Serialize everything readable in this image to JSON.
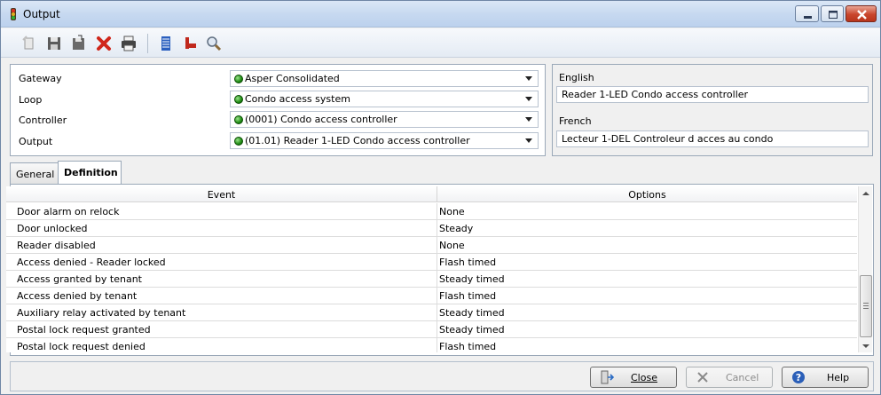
{
  "window": {
    "title": "Output",
    "icon": "traffic-light-icon"
  },
  "toolbar": {
    "buttons": [
      {
        "name": "new-record",
        "icon": "new-icon"
      },
      {
        "name": "save",
        "icon": "floppy-icon"
      },
      {
        "name": "save-and-close",
        "icon": "save-close-icon"
      },
      {
        "name": "delete",
        "icon": "red-x-icon"
      },
      {
        "name": "print",
        "icon": "printer-icon"
      },
      {
        "name": "list",
        "icon": "list-icon"
      },
      {
        "name": "links",
        "icon": "link-icon"
      },
      {
        "name": "search",
        "icon": "magnifier-icon"
      }
    ]
  },
  "form": {
    "gateway_label": "Gateway",
    "gateway_value": "Asper Consolidated",
    "loop_label": "Loop",
    "loop_value": "Condo access system",
    "controller_label": "Controller",
    "controller_value": "(0001) Condo access controller",
    "output_label": "Output",
    "output_value": "(01.01) Reader 1-LED Condo access controller"
  },
  "languages": {
    "english_label": "English",
    "english_value": "Reader 1-LED Condo access controller",
    "french_label": "French",
    "french_value": "Lecteur 1-DEL Controleur d acces au condo"
  },
  "tabs": {
    "general": "General",
    "definition": "Definition"
  },
  "grid": {
    "columns": [
      "Event",
      "Options"
    ],
    "rows": [
      {
        "event": "Door alarm on relock",
        "option": "None"
      },
      {
        "event": "Door unlocked",
        "option": "Steady"
      },
      {
        "event": "Reader disabled",
        "option": "None"
      },
      {
        "event": "Access denied - Reader locked",
        "option": "Flash timed"
      },
      {
        "event": "Access granted by tenant",
        "option": "Steady timed"
      },
      {
        "event": "Access denied by tenant",
        "option": "Flash timed"
      },
      {
        "event": "Auxiliary relay activated by tenant",
        "option": "Steady timed"
      },
      {
        "event": "Postal lock request granted",
        "option": "Steady timed"
      },
      {
        "event": "Postal lock request denied",
        "option": "Flash timed"
      }
    ]
  },
  "buttons": {
    "close": "Close",
    "cancel": "Cancel",
    "help": "Help"
  }
}
